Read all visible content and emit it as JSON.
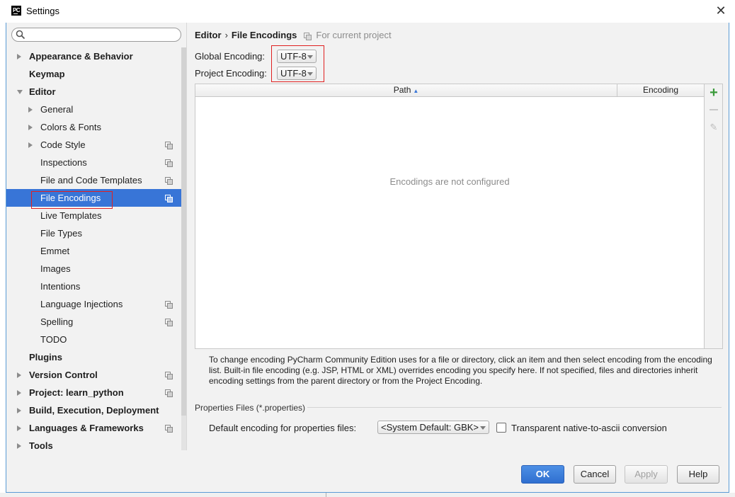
{
  "window": {
    "title": "Settings",
    "app_icon_text": "PC",
    "close_label": "✕"
  },
  "search": {
    "value": "",
    "placeholder": ""
  },
  "tree": {
    "items": [
      {
        "label": "Appearance & Behavior",
        "bold": true,
        "expander": "collapsed",
        "level": 0,
        "project_icon": false
      },
      {
        "label": "Keymap",
        "bold": true,
        "expander": "none",
        "level": 0,
        "project_icon": false
      },
      {
        "label": "Editor",
        "bold": true,
        "expander": "expanded",
        "level": 0,
        "project_icon": false
      },
      {
        "label": "General",
        "bold": false,
        "expander": "collapsed",
        "level": 1,
        "project_icon": false
      },
      {
        "label": "Colors & Fonts",
        "bold": false,
        "expander": "collapsed",
        "level": 1,
        "project_icon": false
      },
      {
        "label": "Code Style",
        "bold": false,
        "expander": "collapsed",
        "level": 1,
        "project_icon": true
      },
      {
        "label": "Inspections",
        "bold": false,
        "expander": "none",
        "level": 1,
        "project_icon": true
      },
      {
        "label": "File and Code Templates",
        "bold": false,
        "expander": "none",
        "level": 1,
        "project_icon": true
      },
      {
        "label": "File Encodings",
        "bold": false,
        "expander": "none",
        "level": 1,
        "project_icon": true,
        "selected": true
      },
      {
        "label": "Live Templates",
        "bold": false,
        "expander": "none",
        "level": 1,
        "project_icon": false
      },
      {
        "label": "File Types",
        "bold": false,
        "expander": "none",
        "level": 1,
        "project_icon": false
      },
      {
        "label": "Emmet",
        "bold": false,
        "expander": "none",
        "level": 1,
        "project_icon": false
      },
      {
        "label": "Images",
        "bold": false,
        "expander": "none",
        "level": 1,
        "project_icon": false
      },
      {
        "label": "Intentions",
        "bold": false,
        "expander": "none",
        "level": 1,
        "project_icon": false
      },
      {
        "label": "Language Injections",
        "bold": false,
        "expander": "none",
        "level": 1,
        "project_icon": true
      },
      {
        "label": "Spelling",
        "bold": false,
        "expander": "none",
        "level": 1,
        "project_icon": true
      },
      {
        "label": "TODO",
        "bold": false,
        "expander": "none",
        "level": 1,
        "project_icon": false
      },
      {
        "label": "Plugins",
        "bold": true,
        "expander": "none",
        "level": 0,
        "project_icon": false
      },
      {
        "label": "Version Control",
        "bold": true,
        "expander": "collapsed",
        "level": 0,
        "project_icon": true
      },
      {
        "label": "Project: learn_python",
        "bold": true,
        "expander": "collapsed",
        "level": 0,
        "project_icon": true
      },
      {
        "label": "Build, Execution, Deployment",
        "bold": true,
        "expander": "collapsed",
        "level": 0,
        "project_icon": false
      },
      {
        "label": "Languages & Frameworks",
        "bold": true,
        "expander": "collapsed",
        "level": 0,
        "project_icon": true
      },
      {
        "label": "Tools",
        "bold": true,
        "expander": "collapsed",
        "level": 0,
        "project_icon": false
      }
    ]
  },
  "breadcrumb": {
    "parent": "Editor",
    "separator": "›",
    "current": "File Encodings",
    "scope_note": "For current project"
  },
  "encodings": {
    "global_label": "Global Encoding:",
    "global_value": "UTF-8",
    "project_label": "Project Encoding:",
    "project_value": "UTF-8"
  },
  "table": {
    "columns": [
      "Path",
      "Encoding"
    ],
    "sort_indicator": "▲",
    "empty_text": "Encodings are not configured",
    "toolbar": {
      "add": "+",
      "edit": "✎"
    }
  },
  "info_text": "To change encoding PyCharm Community Edition uses for a file or directory, click an item and then select encoding from the encoding list. Built-in file encoding (e.g. JSP, HTML or XML) overrides encoding you specify here. If not specified, files and directories inherit encoding settings from the parent directory or from the Project Encoding.",
  "properties": {
    "section_title": "Properties Files (*.properties)",
    "default_label": "Default encoding for properties files:",
    "default_value": "<System Default: GBK>",
    "transparent_label": "Transparent native-to-ascii conversion",
    "transparent_checked": false
  },
  "buttons": {
    "ok": "OK",
    "cancel": "Cancel",
    "apply": "Apply",
    "help": "Help"
  },
  "colors": {
    "selection": "#3875d7",
    "highlight_box": "#e02020",
    "ok_button": "#3b7fdc"
  }
}
